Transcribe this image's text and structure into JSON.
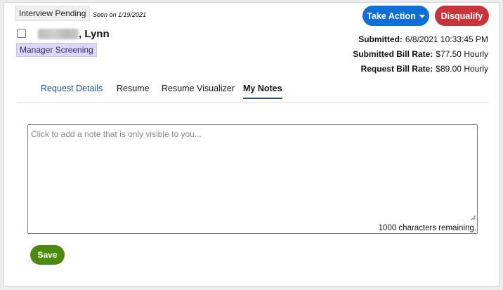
{
  "header": {
    "status_tag": "Interview Pending",
    "seen_text": "Seen on 1/19/2021",
    "candidate_name_suffix": ", Lynn",
    "stage_tag": "Manager Screening"
  },
  "actions": {
    "take_action_label": "Take Action",
    "disqualify_label": "Disqualify"
  },
  "meta": {
    "submitted_label": "Submitted:",
    "submitted_value": "6/8/2021 10:33:45 PM",
    "submitted_bill_rate_label": "Submitted Bill Rate:",
    "submitted_bill_rate_value": "$77.50 Hourly",
    "request_bill_rate_label": "Request Bill Rate:",
    "request_bill_rate_value": "$89.00 Hourly"
  },
  "tabs": [
    {
      "label": "Request Details"
    },
    {
      "label": "Resume"
    },
    {
      "label": "Resume Visualizer"
    },
    {
      "label": "My Notes",
      "active": true
    }
  ],
  "notes": {
    "placeholder": "Click to add a note that is only visible to you...",
    "value": "",
    "char_count": "1000 characters remaining."
  },
  "save_label": "Save",
  "colors": {
    "primary": "#0f6fd6",
    "danger": "#c9343a",
    "success": "#4a8a0c",
    "stage_tag_bg": "#dcd6f7",
    "tab_active_underline": "#1d4f86"
  },
  "icons": {
    "caret": "caret-down-icon",
    "resize": "resize-handle-icon"
  }
}
